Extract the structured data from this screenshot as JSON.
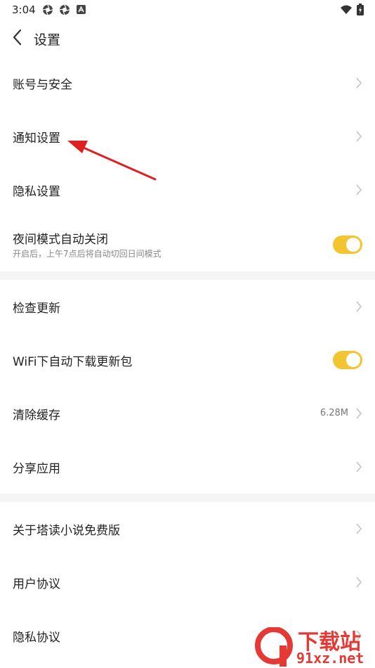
{
  "status_bar": {
    "time": "3:04"
  },
  "header": {
    "title": "设置"
  },
  "rows": [
    {
      "label": "账号与安全"
    },
    {
      "label": "通知设置"
    },
    {
      "label": "隐私设置"
    },
    {
      "label": "夜间模式自动关闭",
      "subtitle": "开启后，上午7点后将自动切回日间模式",
      "toggle_on": true
    },
    {
      "label": "检查更新"
    },
    {
      "label": "WiFi下自动下载更新包",
      "toggle_on": true
    },
    {
      "label": "清除缓存",
      "value": "6.28M"
    },
    {
      "label": "分享应用"
    },
    {
      "label": "关于塔读小说免费版"
    },
    {
      "label": "用户协议"
    },
    {
      "label": "隐私协议"
    }
  ],
  "colors": {
    "toggle_on": "#f2c430",
    "annotation_arrow": "#e02020",
    "watermark": "#e53935"
  },
  "watermark": {
    "brand": "下载站",
    "domain": "91xz.net",
    "logo_text": "9"
  }
}
